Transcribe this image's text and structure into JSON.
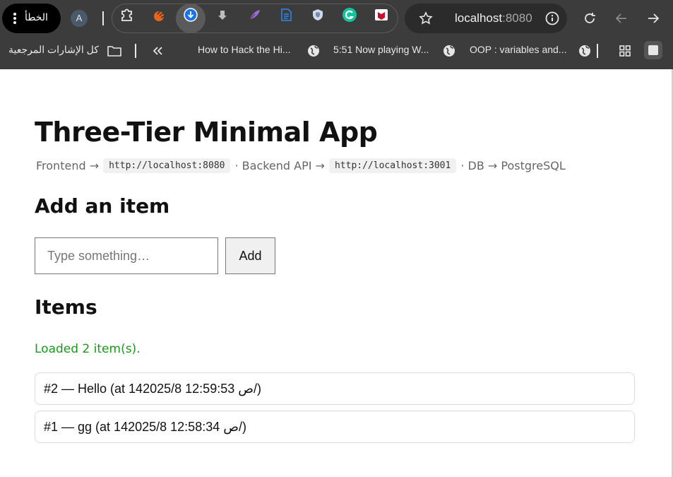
{
  "browser": {
    "error_pill_label": "الخطأ",
    "profile_initial": "A",
    "url_host": "localhost",
    "url_port": ":8080",
    "extensions": [
      "puzzle-icon",
      "swirl-extension-icon",
      "download-manager-icon",
      "download-arrow-icon",
      "feather-extension-icon",
      "document-extension-icon",
      "shield-extension-icon",
      "grammarly-icon",
      "mcafee-icon"
    ]
  },
  "bookmarks": {
    "all_bookmarks_label": "كل الإشارات المرجعية",
    "items": [
      {
        "label": "How to Hack the Hi..."
      },
      {
        "label": "5:51 Now playing W..."
      },
      {
        "label": "OOP : variables and..."
      }
    ]
  },
  "app": {
    "title": "Three-Tier Minimal App",
    "frontend_label": "Frontend →",
    "frontend_url": "http://localhost:8080",
    "backend_label": "· Backend API →",
    "backend_url": "http://localhost:3001",
    "db_label": "· DB → PostgreSQL",
    "add_heading": "Add an item",
    "input_placeholder": "Type something…",
    "input_value": "",
    "add_button": "Add",
    "items_heading": "Items",
    "status": "Loaded 2 item(s).",
    "status_color": "#1a9a1a",
    "items": [
      {
        "text": "#2 — Hello (at 14ص 12:59:53 2025/8/)"
      },
      {
        "text": "#1 — gg (at 14ص 12:58:34 2025/8/)"
      }
    ]
  }
}
